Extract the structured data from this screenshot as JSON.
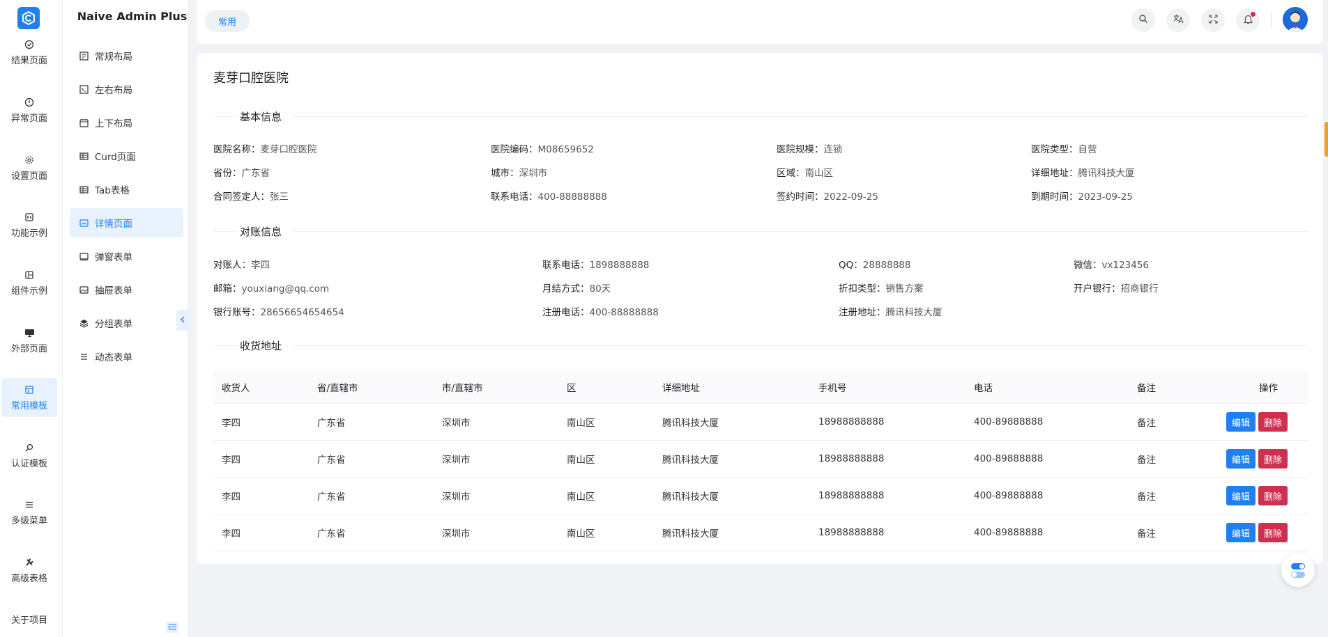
{
  "app": {
    "title": "Naive Admin Plus"
  },
  "rail": {
    "items": [
      {
        "label": "结果页面",
        "icon": "check-circle-icon"
      },
      {
        "label": "异常页面",
        "icon": "exclamation-circle-icon"
      },
      {
        "label": "设置页面",
        "icon": "gear-icon"
      },
      {
        "label": "功能示例",
        "icon": "toolbox-icon"
      },
      {
        "label": "组件示例",
        "icon": "component-icon"
      },
      {
        "label": "外部页面",
        "icon": "monitor-icon"
      },
      {
        "label": "常用模板",
        "icon": "template-icon"
      },
      {
        "label": "认证模板",
        "icon": "search-key-icon"
      },
      {
        "label": "多级菜单",
        "icon": "menu-lines-icon"
      },
      {
        "label": "高级表格",
        "icon": "wrench-icon"
      },
      {
        "label": "关于项目",
        "icon": ""
      }
    ]
  },
  "menu": {
    "items": [
      {
        "label": "常规布局",
        "icon": "layout-icon"
      },
      {
        "label": "左右布局",
        "icon": "terminal-icon"
      },
      {
        "label": "上下布局",
        "icon": "calendar-icon"
      },
      {
        "label": "Curd页面",
        "icon": "table-icon"
      },
      {
        "label": "Tab表格",
        "icon": "table-icon"
      },
      {
        "label": "详情页面",
        "icon": "id-card-icon"
      },
      {
        "label": "弹窗表单",
        "icon": "window-icon"
      },
      {
        "label": "抽屉表单",
        "icon": "image-icon"
      },
      {
        "label": "分组表单",
        "icon": "layers-icon"
      },
      {
        "label": "动态表单",
        "icon": "list-icon"
      }
    ]
  },
  "header": {
    "tab": "常用",
    "buttons": [
      "search-icon",
      "translate-icon",
      "fullscreen-icon",
      "bell-icon"
    ]
  },
  "detail": {
    "title": "麦芽口腔医院",
    "sections": {
      "basic": "基本信息",
      "account": "对账信息",
      "address": "收货地址"
    },
    "basic": [
      {
        "k": "医院名称：",
        "v": "麦芽口腔医院"
      },
      {
        "k": "医院编码：",
        "v": "M08659652"
      },
      {
        "k": "医院规模：",
        "v": "连锁"
      },
      {
        "k": "医院类型：",
        "v": "自营"
      },
      {
        "k": "省份：",
        "v": "广东省"
      },
      {
        "k": "城市：",
        "v": "深圳市"
      },
      {
        "k": "区域：",
        "v": "南山区"
      },
      {
        "k": "详细地址：",
        "v": "腾讯科技大厦"
      },
      {
        "k": "合同签定人：",
        "v": "张三"
      },
      {
        "k": "联系电话：",
        "v": "400-88888888"
      },
      {
        "k": "签约时间：",
        "v": "2022-09-25"
      },
      {
        "k": "到期时间：",
        "v": "2023-09-25"
      }
    ],
    "account": [
      {
        "k": "对账人：",
        "v": "李四"
      },
      {
        "k": "联系电话：",
        "v": "1898888888"
      },
      {
        "k": "QQ：",
        "v": "28888888"
      },
      {
        "k": "微信：",
        "v": "vx123456"
      },
      {
        "k": "邮箱：",
        "v": "youxiang@qq.com"
      },
      {
        "k": "月结方式：",
        "v": "80天"
      },
      {
        "k": "折扣类型：",
        "v": "销售方案"
      },
      {
        "k": "开户银行：",
        "v": "招商银行"
      },
      {
        "k": "银行账号：",
        "v": "28656654654654"
      },
      {
        "k": "注册电话：",
        "v": "400-88888888"
      },
      {
        "k": "注册地址：",
        "v": "腾讯科技大厦"
      }
    ]
  },
  "table": {
    "columns": [
      "收货人",
      "省/直辖市",
      "市/直辖市",
      "区",
      "详细地址",
      "手机号",
      "电话",
      "备注",
      "操作"
    ],
    "rows": [
      [
        "李四",
        "广东省",
        "深圳市",
        "南山区",
        "腾讯科技大厦",
        "18988888888",
        "400-89888888",
        "备注"
      ],
      [
        "李四",
        "广东省",
        "深圳市",
        "南山区",
        "腾讯科技大厦",
        "18988888888",
        "400-89888888",
        "备注"
      ],
      [
        "李四",
        "广东省",
        "深圳市",
        "南山区",
        "腾讯科技大厦",
        "18988888888",
        "400-89888888",
        "备注"
      ],
      [
        "李四",
        "广东省",
        "深圳市",
        "南山区",
        "腾讯科技大厦",
        "18988888888",
        "400-89888888",
        "备注"
      ]
    ],
    "edit_label": "编辑",
    "delete_label": "删除"
  },
  "colors": {
    "primary": "#2080f0",
    "danger": "#d03050",
    "warning": "#f0a020"
  }
}
